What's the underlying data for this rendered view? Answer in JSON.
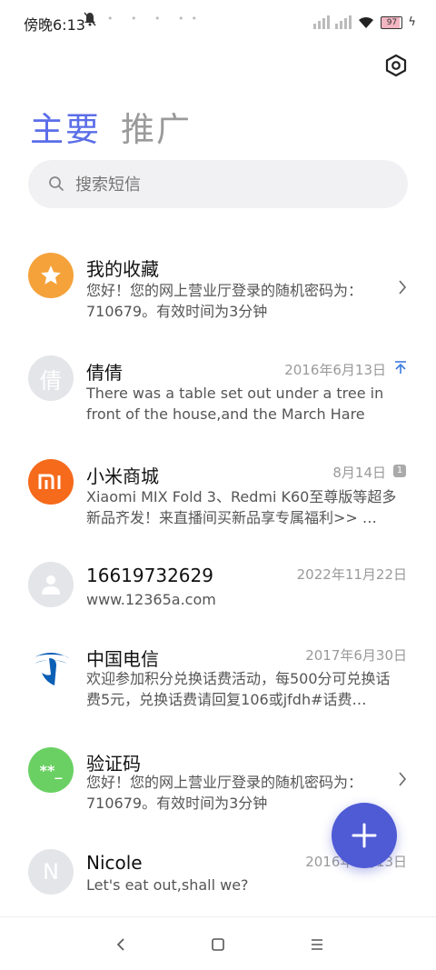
{
  "status_bar": {
    "time": "傍晚6:13",
    "battery": "97"
  },
  "tabs": [
    {
      "label": "主要",
      "active": true
    },
    {
      "label": "推广",
      "active": false
    }
  ],
  "search": {
    "placeholder": "搜索短信"
  },
  "conversations": [
    {
      "name": "我的收藏",
      "date": "",
      "preview": "您好！您的网上营业厅登录的随机密码为：710679。有效时间为3分钟",
      "avatar": "star-icon",
      "avatar_color": "#f5a23a",
      "indicator": "chevron"
    },
    {
      "name": "倩倩",
      "date": "2016年6月13日",
      "preview": "There was a table set out under a tree in front of the house,and the March Hare an…",
      "avatar": "倩",
      "avatar_color": "#e4e5e9",
      "indicator": "pin"
    },
    {
      "name": "小米商城",
      "date": "8月14日",
      "preview": "Xiaomi MIX Fold 3、Redmi K60至尊版等超多新品齐发！来直播间买新品享专属福利>> …",
      "avatar": "mi-logo-icon",
      "avatar_color": "#f56a1b",
      "indicator": "badge",
      "badge": "1"
    },
    {
      "name": "16619732629",
      "date": "2022年11月22日",
      "preview": "www.12365a.com",
      "avatar": "person-icon",
      "avatar_color": "#e4e5e9",
      "indicator": ""
    },
    {
      "name": "中国电信",
      "date": "2017年6月30日",
      "preview": "欢迎参加积分兑换话费活动，每500分可兑换话费5元，兑换话费请回复106或jfdh#话费…",
      "avatar": "china-telecom-logo-icon",
      "avatar_color": "#ffffff",
      "indicator": ""
    },
    {
      "name": "验证码",
      "date": "",
      "preview": "您好！您的网上营业厅登录的随机密码为：710679。有效时间为3分钟",
      "avatar": "**_",
      "avatar_color": "#6ad063",
      "indicator": "chevron"
    },
    {
      "name": "Nicole",
      "date": "2016年6月13日",
      "preview": "Let's eat out,shall we?",
      "avatar": "N",
      "avatar_color": "#e4e5e9",
      "indicator": ""
    }
  ],
  "fab": {
    "icon": "plus-icon",
    "color": "#4f5bd5"
  },
  "nav": {
    "back": "back-icon",
    "home": "home-icon",
    "recents": "menu-icon"
  }
}
